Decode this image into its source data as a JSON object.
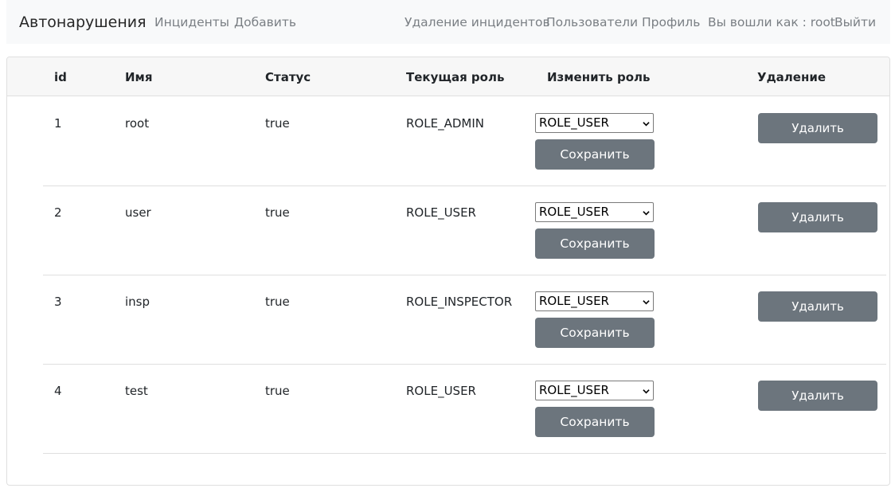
{
  "navbar": {
    "brand": "Автонарушения",
    "links_left": [
      "Инциденты",
      "Добавить"
    ],
    "links_right": [
      "Удаление инцидентов",
      "Пользователи",
      "Профиль",
      "Вы вошли как : root",
      "Выйти"
    ]
  },
  "table": {
    "headers": [
      "id",
      "Имя",
      "Статус",
      "Текущая роль",
      "Изменить роль",
      "Удаление"
    ],
    "rows": [
      {
        "id": "1",
        "name": "root",
        "status": "true",
        "role": "ROLE_ADMIN",
        "select_value": "ROLE_USER",
        "save_label": "Сохранить",
        "delete_label": "Удалить"
      },
      {
        "id": "2",
        "name": "user",
        "status": "true",
        "role": "ROLE_USER",
        "select_value": "ROLE_USER",
        "save_label": "Сохранить",
        "delete_label": "Удалить"
      },
      {
        "id": "3",
        "name": "insp",
        "status": "true",
        "role": "ROLE_INSPECTOR",
        "select_value": "ROLE_USER",
        "save_label": "Сохранить",
        "delete_label": "Удалить"
      },
      {
        "id": "4",
        "name": "test",
        "status": "true",
        "role": "ROLE_USER",
        "select_value": "ROLE_USER",
        "save_label": "Сохранить",
        "delete_label": "Удалить"
      }
    ]
  },
  "colors": {
    "navbar_bg": "#f8f9fa",
    "button_secondary": "#6c757d",
    "header_bg": "#f7f7f7"
  },
  "icons": {
    "select_caret": "chevron-down-icon"
  }
}
